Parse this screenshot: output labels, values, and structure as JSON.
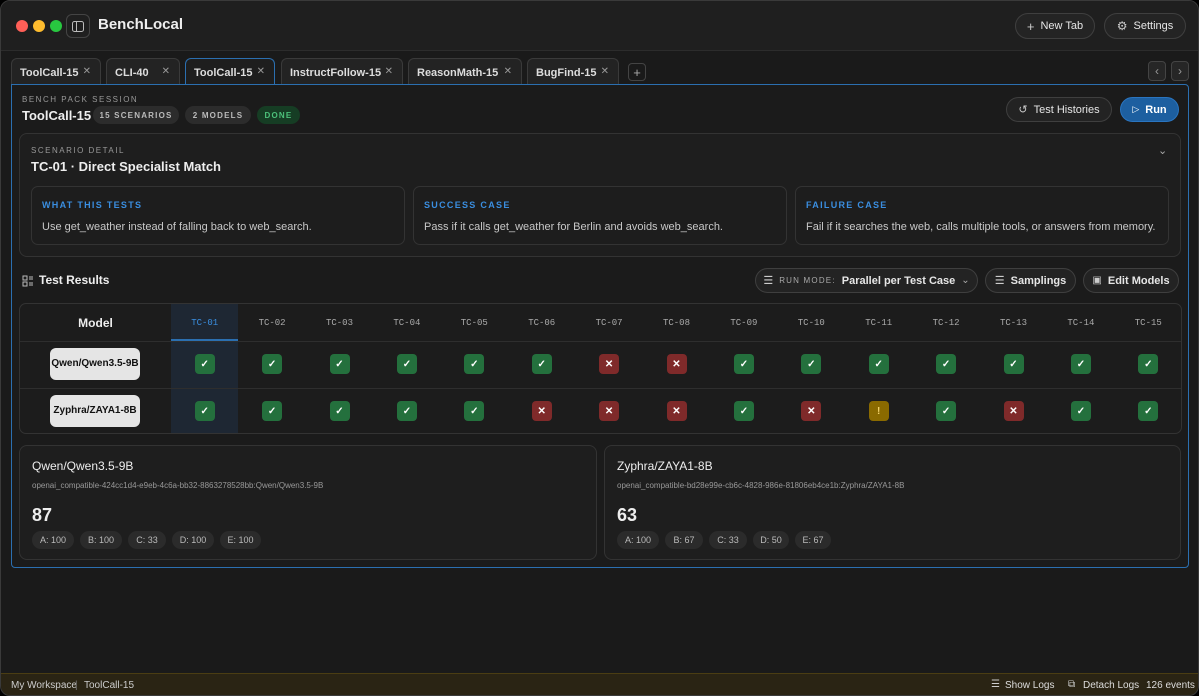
{
  "app": {
    "title": "BenchLocal",
    "new_tab": "New Tab",
    "settings": "Settings"
  },
  "tabs": [
    {
      "label": "ToolCall-15"
    },
    {
      "label": "CLI-40"
    },
    {
      "label": "ToolCall-15"
    },
    {
      "label": "InstructFollow-15"
    },
    {
      "label": "ReasonMath-15"
    },
    {
      "label": "BugFind-15"
    }
  ],
  "session": {
    "section_label": "BENCH PACK SESSION",
    "name": "ToolCall-15",
    "scenarios": "15 SCENARIOS",
    "models": "2 MODELS",
    "status": "DONE",
    "histories": "Test Histories",
    "run": "Run"
  },
  "scenario": {
    "section_label": "SCENARIO DETAIL",
    "title": "TC-01 · Direct Specialist Match",
    "what_h": "WHAT THIS TESTS",
    "what_t": "Use get_weather instead of falling back to web_search.",
    "success_h": "SUCCESS CASE",
    "success_t": "Pass if it calls get_weather for Berlin and avoids web_search.",
    "failure_h": "FAILURE CASE",
    "failure_t": "Fail if it searches the web, calls multiple tools, or answers from memory."
  },
  "results": {
    "title": "Test Results",
    "run_mode_label": "RUN MODE:",
    "run_mode_value": "Parallel per Test Case",
    "samplings": "Samplings",
    "edit_models": "Edit Models",
    "model_header": "Model",
    "columns": [
      "TC-01",
      "TC-02",
      "TC-03",
      "TC-04",
      "TC-05",
      "TC-06",
      "TC-07",
      "TC-08",
      "TC-09",
      "TC-10",
      "TC-11",
      "TC-12",
      "TC-13",
      "TC-14",
      "TC-15"
    ],
    "rows": [
      {
        "model": "Qwen/Qwen3.5-9B",
        "results": [
          "pass",
          "pass",
          "pass",
          "pass",
          "pass",
          "pass",
          "fail",
          "fail",
          "pass",
          "pass",
          "pass",
          "pass",
          "pass",
          "pass",
          "pass"
        ]
      },
      {
        "model": "Zyphra/ZAYA1-8B",
        "results": [
          "pass",
          "pass",
          "pass",
          "pass",
          "pass",
          "fail",
          "fail",
          "fail",
          "pass",
          "fail",
          "warn",
          "pass",
          "fail",
          "pass",
          "pass"
        ]
      }
    ],
    "status_colors": {
      "pass": "#24703d",
      "fail": "#7f2a2a",
      "warn": "#8a6a00"
    }
  },
  "summaries": [
    {
      "name": "Qwen/Qwen3.5-9B",
      "id": "openai_compatible-424cc1d4-e9eb-4c6a-bb32-8863278528bb:Qwen/Qwen3.5-9B",
      "score": "87",
      "cats": [
        "A: 100",
        "B: 100",
        "C: 33",
        "D: 100",
        "E: 100"
      ]
    },
    {
      "name": "Zyphra/ZAYA1-8B",
      "id": "openai_compatible-bd28e99e-cb6c-4828-986e-81806eb4ce1b:Zyphra/ZAYA1-8B",
      "score": "63",
      "cats": [
        "A: 100",
        "B: 67",
        "C: 33",
        "D: 50",
        "E: 67"
      ]
    }
  ],
  "statusbar": {
    "workspace": "My Workspace",
    "pack": "ToolCall-15",
    "show_logs": "Show Logs",
    "detach_logs": "Detach Logs",
    "events": "126 events"
  }
}
